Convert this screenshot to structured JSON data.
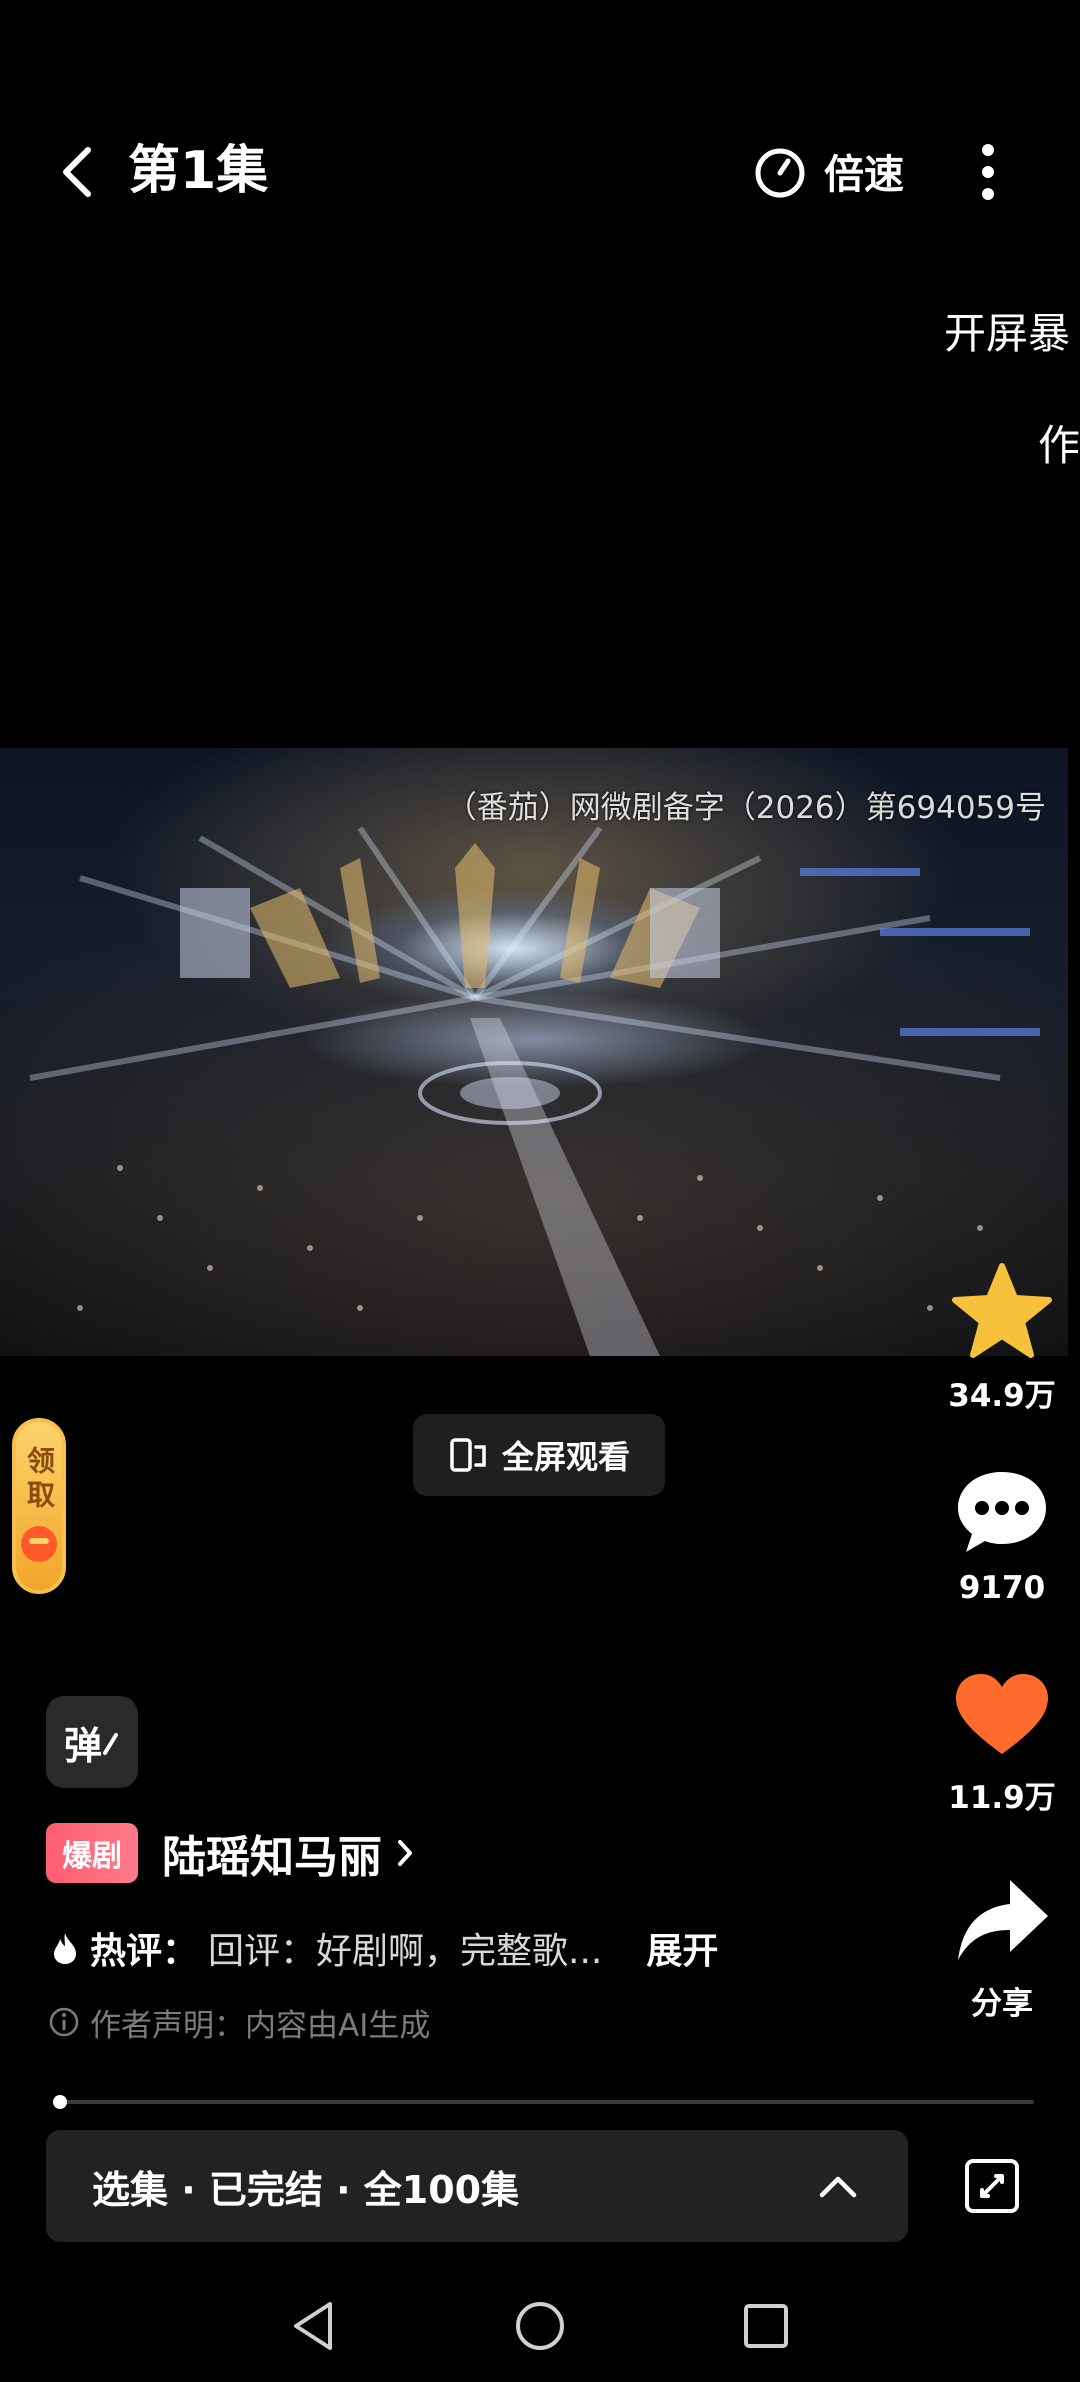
{
  "header": {
    "back_icon": "back-arrow-icon",
    "title": "第1集",
    "speed_label": "倍速",
    "speed_icon": "timer-icon",
    "more_icon": "more-vertical-icon"
  },
  "marquee": {
    "line1": "开屏暴",
    "line2": "作"
  },
  "video": {
    "license": "（番茄）网微剧备字（2026）第694059号"
  },
  "actions": {
    "favorite": {
      "icon": "star-icon",
      "count": "34.9万",
      "color": "#f7c23b"
    },
    "comment": {
      "icon": "comment-bubble-icon",
      "count": "9170"
    },
    "like": {
      "icon": "heart-icon",
      "count": "11.9万",
      "color": "#ff6b2c"
    },
    "share": {
      "icon": "share-arrow-icon",
      "label": "分享"
    }
  },
  "fullscreen": {
    "label": "全屏观看",
    "icon": "fullscreen-rotate-icon"
  },
  "reward": {
    "label": "领取"
  },
  "danmaku": {
    "label": "弹"
  },
  "drama": {
    "badge": "爆剧",
    "name": "陆瑶知马丽",
    "hot_label": "热评：",
    "hot_text": "回评：好剧啊，完整歌...",
    "expand": "展开",
    "disclaimer": "作者声明：内容由AI生成"
  },
  "progress": {
    "fraction": 0.006
  },
  "episodes": {
    "label": "选集 · 已完结 · 全100集"
  },
  "colors": {
    "accent_badge": "#ff5d72",
    "background": "#000000"
  }
}
